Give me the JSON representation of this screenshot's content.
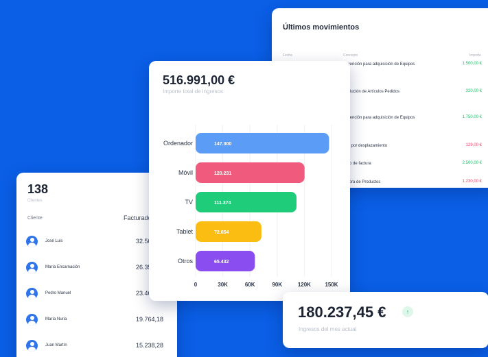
{
  "movements": {
    "title": "Últimos movimientos",
    "headers": [
      "Fecha",
      "Concepto",
      "Importe"
    ],
    "rows": [
      {
        "concept": "Subvención para adquisición de Equipos",
        "amount": "1.500,00 €",
        "status": "positive"
      },
      {
        "concept": "Devolución de Artículos Pedidos",
        "amount": "320,00 €",
        "status": "positive"
      },
      {
        "concept": "Subvención para adquisición de Equipos",
        "amount": "1.750,00 €",
        "status": "positive"
      },
      {
        "concept": "Dieta por desplazamiento",
        "amount": "129,00 €",
        "status": "negative"
      },
      {
        "concept": "Cobro de factura",
        "amount": "2.500,00 €",
        "status": "positive"
      },
      {
        "concept": "Compra de Productos",
        "amount": "1.230,00 €",
        "status": "negative"
      }
    ]
  },
  "clients": {
    "count": "138",
    "count_label": "Clientes",
    "col_client": "Cliente",
    "col_invoice": "Facturado",
    "rows": [
      {
        "name": "José Luis",
        "value": "32.500,00"
      },
      {
        "name": "María Encarnación",
        "value": "26.350,00"
      },
      {
        "name": "Pedro Manuel",
        "value": "23.465,00"
      },
      {
        "name": "María Nuria",
        "value": "19.764,18"
      },
      {
        "name": "Juan Martín",
        "value": "15.238,28"
      }
    ]
  },
  "income": {
    "total": "516.991,00 €",
    "total_label": "Importe total de ingresos"
  },
  "monthly": {
    "amount": "180.237,45 €",
    "trend_icon": "arrow-up-icon",
    "trend_glyph": "↑",
    "label": "Ingresos del mes actual"
  },
  "colors": {
    "background": "#0a5fe6",
    "positive": "#21c16b",
    "negative": "#f0436b"
  },
  "chart_data": {
    "type": "bar",
    "orientation": "horizontal",
    "categories": [
      "Ordenador",
      "Móvil",
      "TV",
      "Tablet",
      "Otros"
    ],
    "values": [
      147300,
      120231,
      111374,
      72654,
      65432
    ],
    "value_labels": [
      "147.300",
      "120.231",
      "111.374",
      "72.654",
      "65.432"
    ],
    "colors": [
      "#5b9cf6",
      "#ef5a7d",
      "#1fcc7a",
      "#fcbd12",
      "#8a4ef0"
    ],
    "xlim": [
      0,
      150000
    ],
    "xticks": [
      0,
      30000,
      60000,
      90000,
      120000,
      150000
    ],
    "xtick_labels": [
      "0",
      "30K",
      "60K",
      "90K",
      "120K",
      "150K"
    ],
    "grid": true
  }
}
